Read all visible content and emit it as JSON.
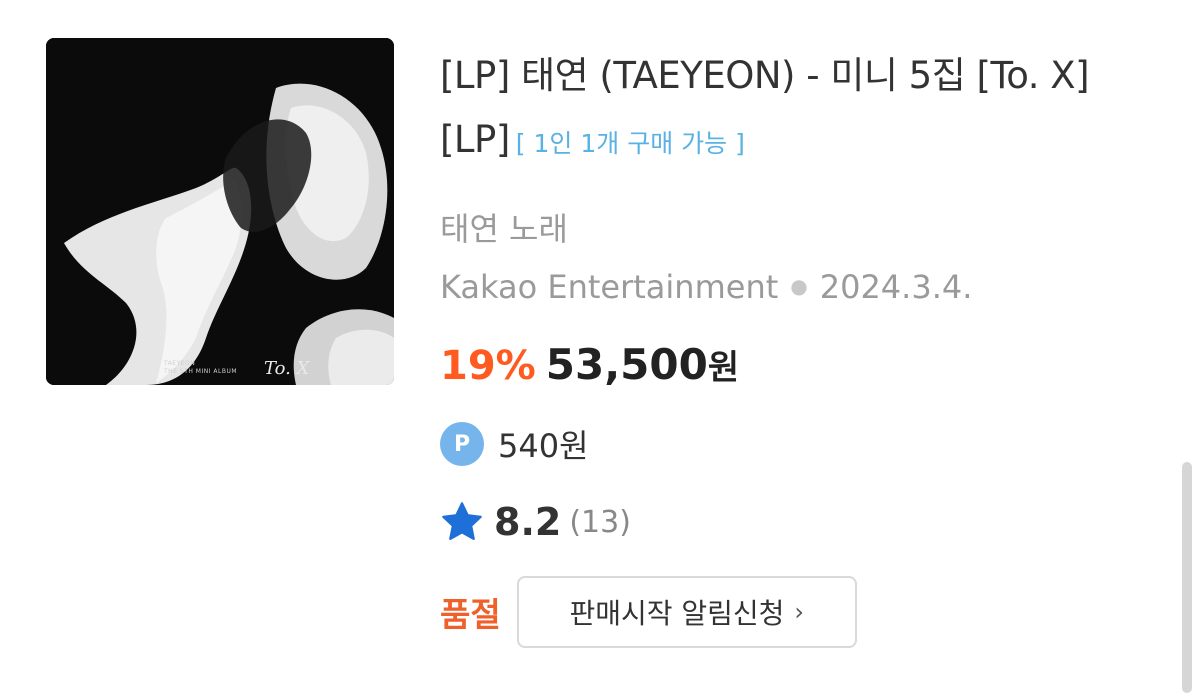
{
  "product": {
    "title": "[LP] 태연 (TAEYEON) - 미니 5집 [To. X] [LP]",
    "purchase_limit": "[ 1인 1개 구매 가능 ]",
    "artist": "태연 노래",
    "publisher": "Kakao Entertainment",
    "release_date": "2024.3.4.",
    "discount": "19%",
    "price": "53,500",
    "price_unit": "원",
    "point_label": "P",
    "points": "540원",
    "rating": "8.2",
    "review_count": "(13)",
    "status": "품절",
    "notify_button_label": "판매시작 알림신청",
    "cover": {
      "caption_line1": "TAEYEON",
      "caption_line2": "THE 5TH MINI ALBUM",
      "signature": "To. X"
    }
  },
  "colors": {
    "discount": "#ff5a1f",
    "soldout": "#f0602a",
    "limit_text": "#5ab1e3",
    "point_badge": "#76b5ec",
    "star": "#1f6fd8"
  },
  "icons": {
    "point": "point-badge-icon",
    "rating": "star-icon",
    "chevron": "chevron-right-icon"
  }
}
